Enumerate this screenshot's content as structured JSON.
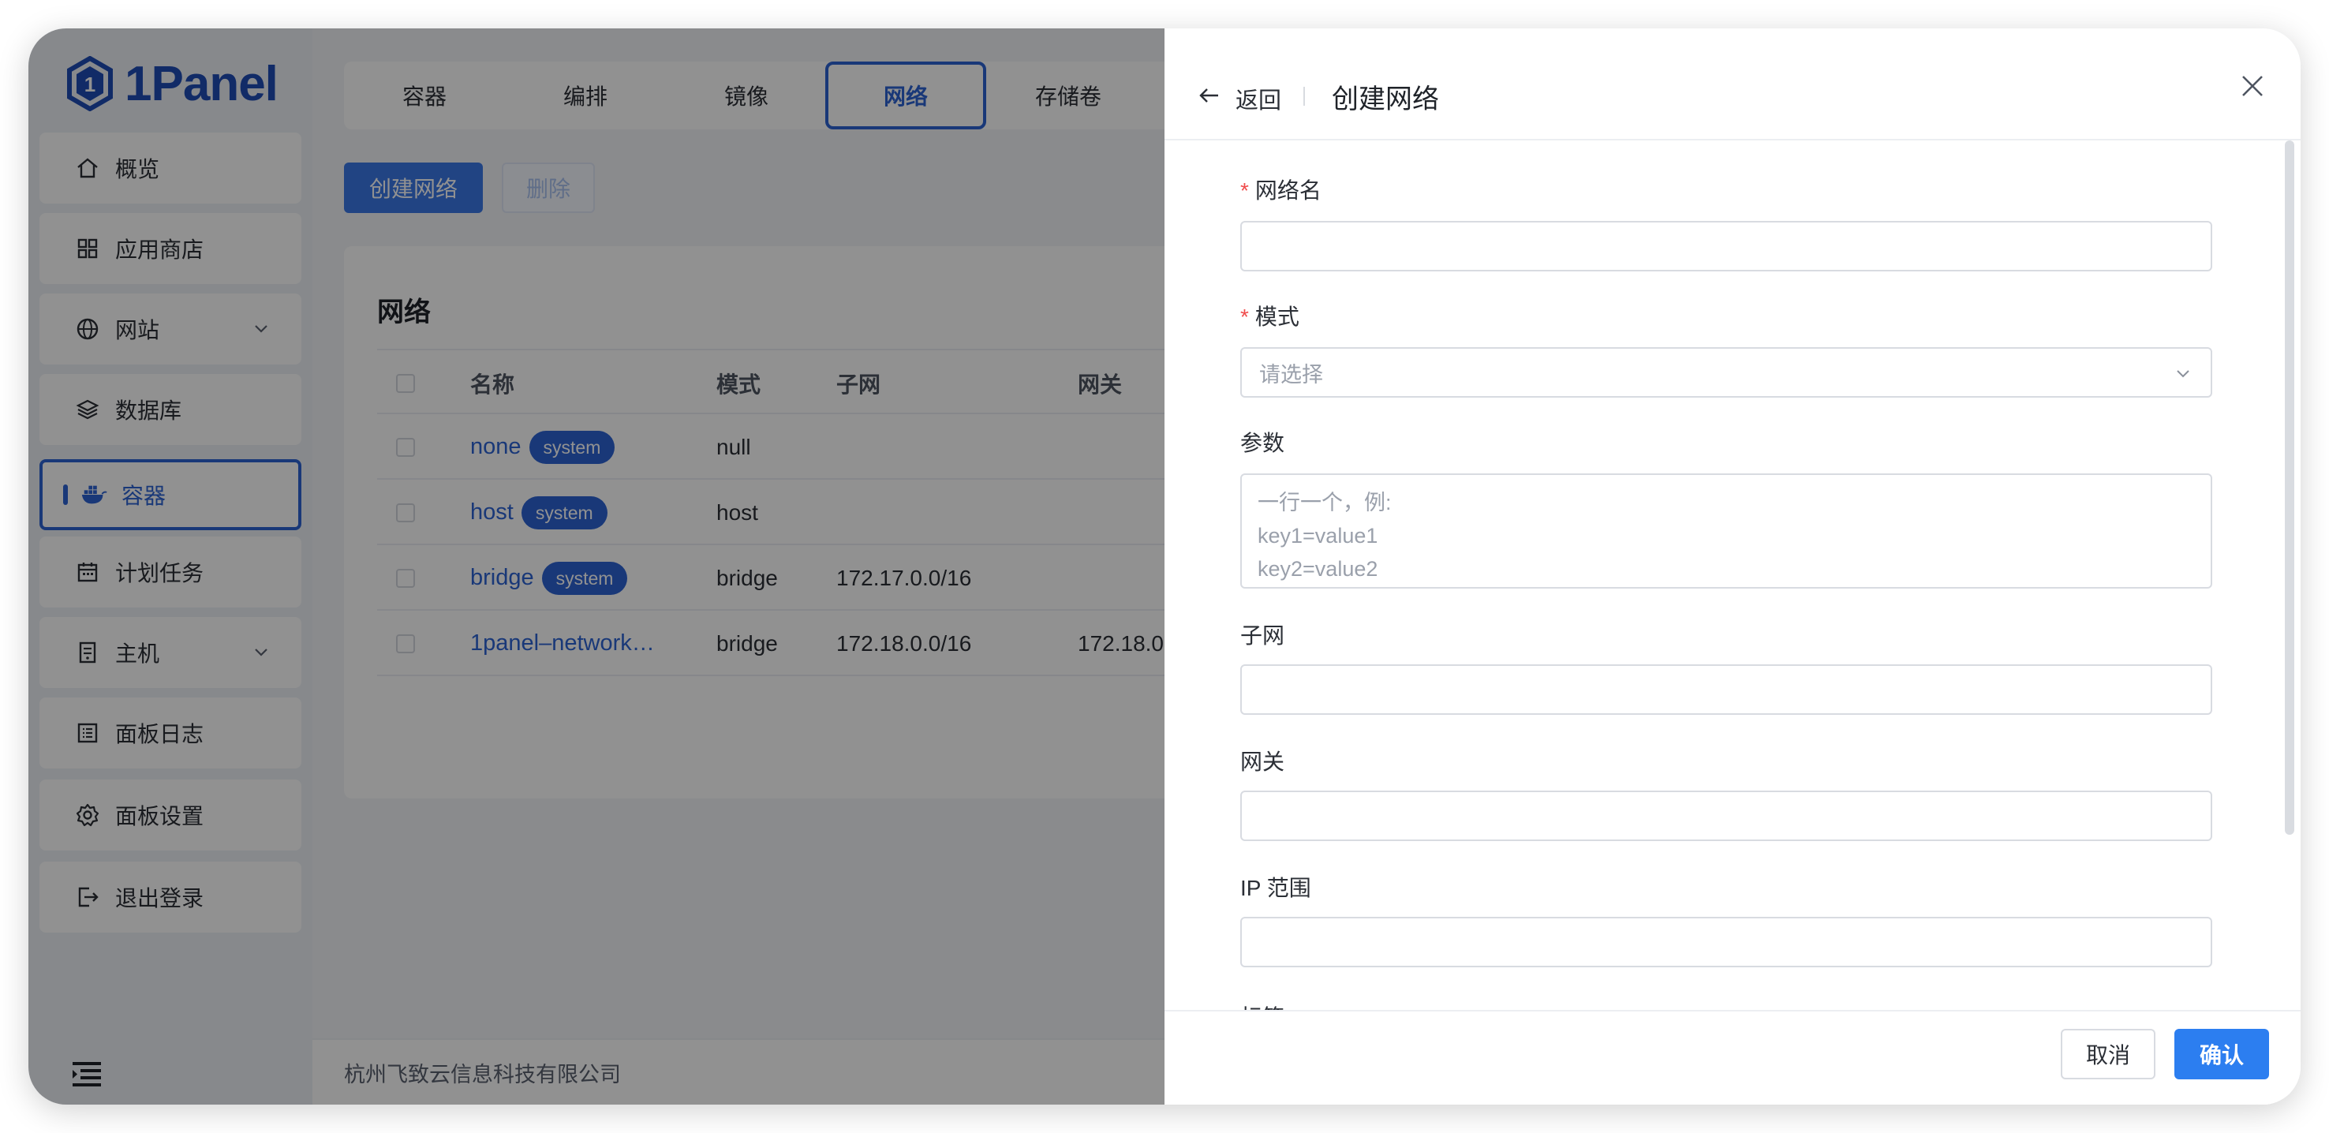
{
  "app": {
    "logo_text": "1Panel"
  },
  "sidebar": {
    "items": [
      {
        "label": "概览",
        "icon": "home-icon"
      },
      {
        "label": "应用商店",
        "icon": "grid-icon"
      },
      {
        "label": "网站",
        "icon": "globe-icon",
        "expandable": true
      },
      {
        "label": "数据库",
        "icon": "layers-icon"
      },
      {
        "label": "容器",
        "icon": "docker-icon",
        "active": true
      },
      {
        "label": "计划任务",
        "icon": "calendar-icon"
      },
      {
        "label": "主机",
        "icon": "server-icon",
        "expandable": true
      },
      {
        "label": "面板日志",
        "icon": "log-icon"
      },
      {
        "label": "面板设置",
        "icon": "gear-icon"
      },
      {
        "label": "退出登录",
        "icon": "logout-icon"
      }
    ]
  },
  "tabs": [
    "容器",
    "编排",
    "镜像",
    "网络",
    "存储卷"
  ],
  "active_tab": "网络",
  "toolbar": {
    "create_label": "创建网络",
    "delete_label": "删除"
  },
  "card": {
    "title": "网络",
    "columns": [
      "名称",
      "模式",
      "子网",
      "网关"
    ],
    "rows": [
      {
        "name": "none",
        "badge": "system",
        "mode": "null",
        "subnet": "",
        "gateway": ""
      },
      {
        "name": "host",
        "badge": "system",
        "mode": "host",
        "subnet": "",
        "gateway": ""
      },
      {
        "name": "bridge",
        "badge": "system",
        "mode": "bridge",
        "subnet": "172.17.0.0/16",
        "gateway": ""
      },
      {
        "name": "1panel–network…",
        "badge": "",
        "mode": "bridge",
        "subnet": "172.18.0.0/16",
        "gateway": "172.18.0"
      }
    ]
  },
  "footer": {
    "company": "杭州飞致云信息科技有限公司"
  },
  "drawer": {
    "back_label": "返回",
    "title": "创建网络",
    "fields": {
      "name_label": "网络名",
      "required_mark": "*",
      "mode_label": "模式",
      "mode_placeholder": "请选择",
      "params_label": "参数",
      "params_placeholder": "一行一个，例:\nkey1=value1\nkey2=value2",
      "subnet_label": "子网",
      "gateway_label": "网关",
      "iprange_label": "IP 范围",
      "tags_label": "标签"
    },
    "cancel_label": "取消",
    "confirm_label": "确认"
  },
  "colors": {
    "primary": "#2c63d4",
    "confirm": "#2c7ef0",
    "required": "#f04d4d"
  }
}
